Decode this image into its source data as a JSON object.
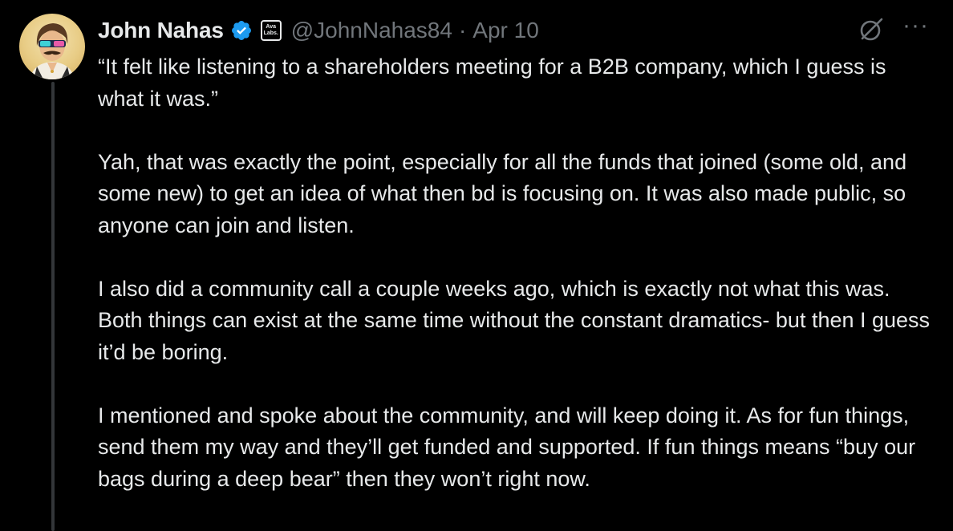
{
  "tweet": {
    "display_name": "John Nahas",
    "affiliate_badge": "Ava Labs.",
    "affiliate_badge_line1": "Ava",
    "affiliate_badge_line2": "Labs.",
    "handle": "@JohnNahas84",
    "separator": "·",
    "date": "Apr 10",
    "paragraphs": [
      "“It felt like listening to a shareholders meeting for a B2B company, which I guess is what it was.”",
      "Yah, that was exactly the point, especially for all the funds that joined (some old, and some new) to get an idea of what then bd is focusing on. It was also made public, so anyone can join and listen.",
      "I also did a community call a couple weeks ago, which is exactly not what this was. Both things can exist at the same time without the constant dramatics- but then I guess it’d be boring.",
      "I mentioned and spoke about the community, and will keep doing it. As for fun things, send them my way and they’ll get funded and supported. If fun things means “buy our bags during a deep bear” then they won’t right now."
    ]
  },
  "icons": {
    "verified": "verified-badge-icon",
    "grok": "grok-icon",
    "more": "more-options-icon"
  },
  "colors": {
    "background": "#000000",
    "text_primary": "#e7e9ea",
    "text_secondary": "#71767b",
    "verified_blue": "#1d9bf0",
    "thread_line": "#333639"
  },
  "more_glyph": "···"
}
